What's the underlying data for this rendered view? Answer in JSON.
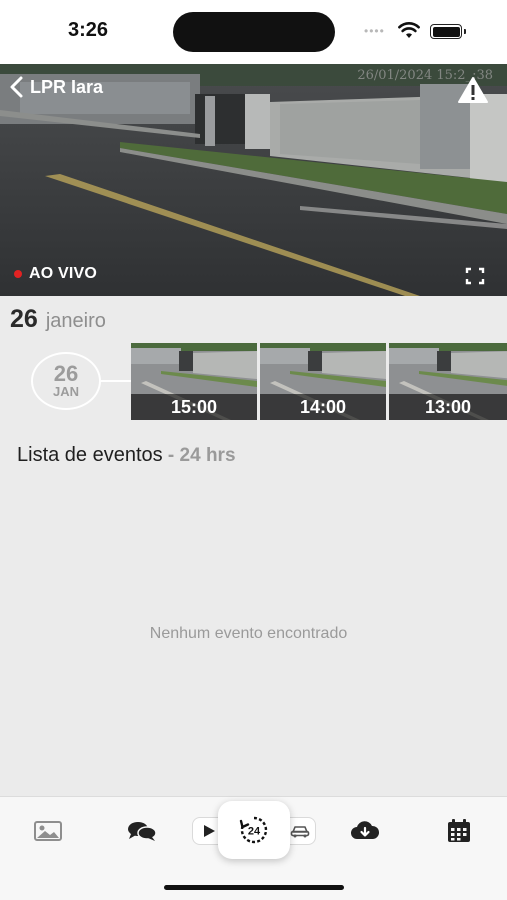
{
  "status_bar": {
    "time": "3:26",
    "signal_dots": "••••"
  },
  "camera": {
    "title": "LPR Iara",
    "timestamp": "26/01/2024 15:2_:38",
    "live_label": "AO VIVO",
    "icons": {
      "back": "chevron-left-icon",
      "alert": "warning-triangle-icon",
      "fullscreen": "fullscreen-icon"
    }
  },
  "timeline": {
    "date_header": {
      "day": "26",
      "month": "janeiro"
    },
    "date_badge": {
      "day": "26",
      "month": "JAN"
    },
    "thumbnails": [
      {
        "label": "15:00"
      },
      {
        "label": "14:00"
      },
      {
        "label": "13:00"
      }
    ]
  },
  "events": {
    "title": "Lista de eventos",
    "range": " - 24 hrs",
    "empty_message": "Nenhum evento encontrado"
  },
  "tab_bar": {
    "items": [
      {
        "name": "gallery",
        "icon": "image-icon"
      },
      {
        "name": "chat",
        "icon": "chat-bubbles-icon"
      },
      {
        "name": "play",
        "icon": "play-icon"
      },
      {
        "name": "history-24h",
        "icon": "history-24-icon",
        "active": true
      },
      {
        "name": "vehicle",
        "icon": "car-icon"
      },
      {
        "name": "download",
        "icon": "cloud-download-icon"
      },
      {
        "name": "calendar",
        "icon": "calendar-icon"
      }
    ]
  },
  "colors": {
    "live_dot": "#e22222",
    "background": "#ebebeb",
    "tab_bar": "#f7f7f7"
  }
}
